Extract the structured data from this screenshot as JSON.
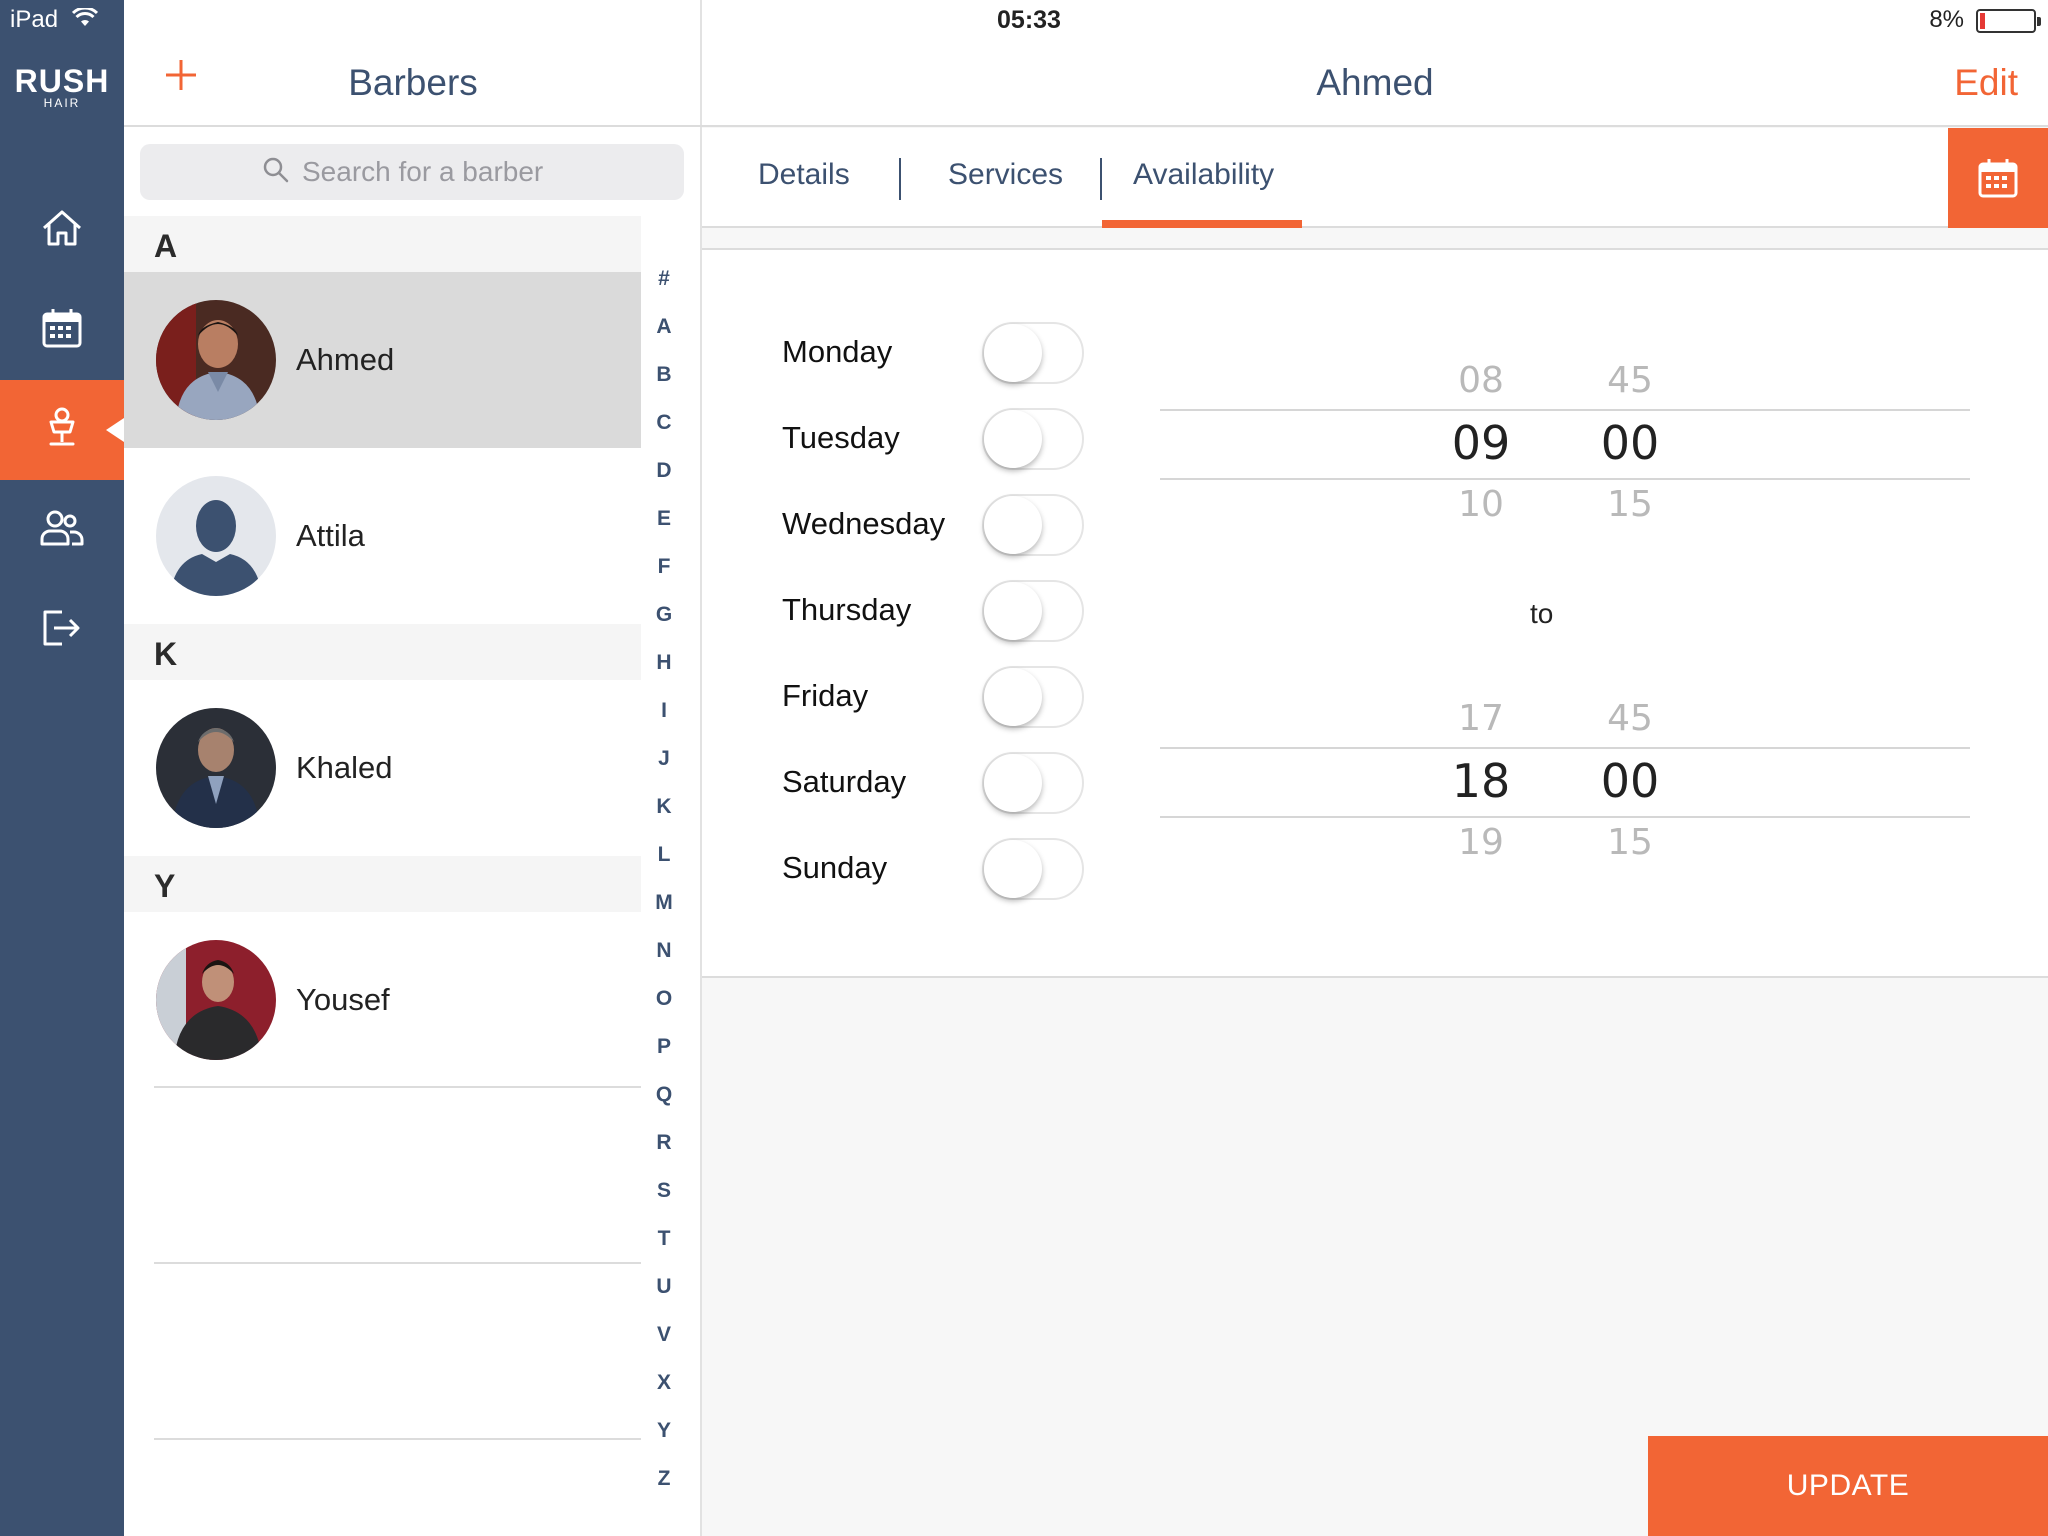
{
  "status_bar": {
    "device": "iPad",
    "time": "05:33",
    "battery": "8%"
  },
  "colors": {
    "accent": "#f26535",
    "nav_bg": "#3c5170",
    "text": "#3c5170"
  },
  "sidebar": {
    "logo_main": "RUSH",
    "logo_sub": "HAIR",
    "items": [
      {
        "icon": "home-icon"
      },
      {
        "icon": "calendar-icon"
      },
      {
        "icon": "barber-chair-icon",
        "active": true
      },
      {
        "icon": "clients-icon"
      },
      {
        "icon": "logout-icon"
      }
    ]
  },
  "master": {
    "title": "Barbers",
    "search_placeholder": "Search for a barber",
    "sections": [
      {
        "letter": "A",
        "barbers": [
          {
            "name": "Ahmed",
            "selected": true
          },
          {
            "name": "Attila"
          }
        ]
      },
      {
        "letter": "K",
        "barbers": [
          {
            "name": "Khaled"
          }
        ]
      },
      {
        "letter": "Y",
        "barbers": [
          {
            "name": "Yousef"
          }
        ]
      }
    ],
    "index": [
      "#",
      "A",
      "B",
      "C",
      "D",
      "E",
      "F",
      "G",
      "H",
      "I",
      "J",
      "K",
      "L",
      "M",
      "N",
      "O",
      "P",
      "Q",
      "R",
      "S",
      "T",
      "U",
      "V",
      "X",
      "Y",
      "Z"
    ]
  },
  "detail": {
    "title": "Ahmed",
    "edit_label": "Edit",
    "tabs": [
      "Details",
      "Services",
      "Availability"
    ],
    "active_tab": "Availability",
    "days": [
      {
        "label": "Monday",
        "on": false
      },
      {
        "label": "Tuesday",
        "on": false
      },
      {
        "label": "Wednesday",
        "on": false
      },
      {
        "label": "Thursday",
        "on": false
      },
      {
        "label": "Friday",
        "on": false
      },
      {
        "label": "Saturday",
        "on": false
      },
      {
        "label": "Sunday",
        "on": false
      }
    ],
    "start_picker": {
      "hour_prev": "08",
      "hour": "09",
      "hour_next": "10",
      "min_prev": "45",
      "min": "00",
      "min_next": "15"
    },
    "to_label": "to",
    "end_picker": {
      "hour_prev": "17",
      "hour": "18",
      "hour_next": "19",
      "min_prev": "45",
      "min": "00",
      "min_next": "15"
    },
    "update_label": "UPDATE"
  }
}
